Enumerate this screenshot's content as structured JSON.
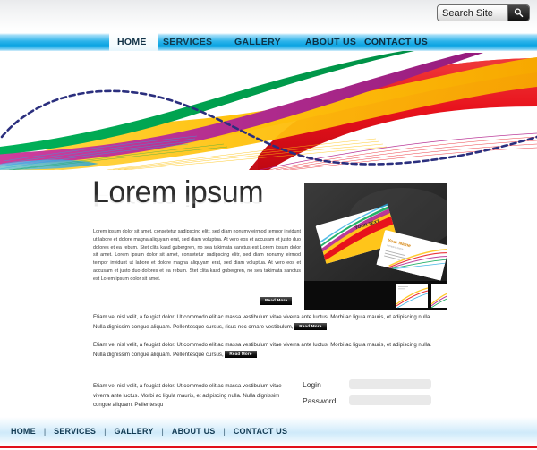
{
  "search": {
    "value": "Search Site",
    "placeholder": "Search Site",
    "icon": "magnifier-icon"
  },
  "nav": {
    "items": [
      {
        "label": "HOME",
        "active": true
      },
      {
        "label": "SERVICES",
        "active": false
      },
      {
        "label": "GALLERY",
        "active": false
      },
      {
        "label": "ABOUT US",
        "active": false
      },
      {
        "label": "CONTACT US",
        "active": false
      }
    ]
  },
  "banner": {
    "alt": "colorful flowing ribbon wave graphic",
    "colors": {
      "yellow": "#ffc20e",
      "red": "#e8121c",
      "magenta": "#b2238d",
      "green": "#00a44f",
      "cyan": "#29abe2",
      "navy_dashed": "#2b2f7e"
    }
  },
  "main": {
    "headline": "Lorem ipsum",
    "lead": "Lorem ipsum dolor sit amet, consetetur sadipscing elitr, sed diam nonumy eirmod tempor invidunt ut labore et dolore magna aliquyam erat, sed diam voluptua. At vero eos et accusam et justo duo dolores et ea rebum. Stet clita kasd gubergren, no sea takimata sanctus est Lorem ipsum dolor sit amet. Lorem ipsum dolor sit amet, consetetur sadipscing elitr, sed diam nonumy eirmod tempor invidunt ut labore et dolore magna aliquyam erat, sed diam voluptua. At vero eos et accusam et justo duo dolores et ea rebum. Stet clita kasd gubergren, no sea takimata sanctus est Lorem ipsum dolor sit amet.",
    "read_more": "Read More",
    "promo_image": {
      "alt": "business card design mockup on dark background",
      "card_text": "YOUR TEXT",
      "card_name": "Your Name"
    },
    "paragraph_1": "Etiam vel nisl velit, a feugiat dolor. Ut commodo elit ac massa vestibulum vitae viverra ante luctus. Morbi ac ligula mauris, et adipiscing nulla. Nulla dignissim congue aliquam. Pellentesque cursus, risus nec ornare vestibulum,",
    "paragraph_2": "Etiam vel nisl velit, a feugiat dolor. Ut commodo elit ac massa vestibulum vitae viverra ante luctus. Morbi ac ligula mauris, et adipiscing nulla. Nulla dignissim congue aliquam. Pellentesque cursus,",
    "bottom_text": "Etiam vel nisl velit, a feugiat dolor. Ut commodo elit ac massa vestibulum vitae viverra ante luctus. Morbi ac ligula mauris, et adipiscing nulla. Nulla dignissim congue aliquam. Pellentesqu"
  },
  "login": {
    "login_label": "Login",
    "password_label": "Password",
    "login_value": "",
    "password_value": "",
    "login_placeholder": "",
    "password_placeholder": ""
  },
  "footer": {
    "separator": "|",
    "items": [
      {
        "label": "HOME"
      },
      {
        "label": "SERVICES"
      },
      {
        "label": "GALLERY"
      },
      {
        "label": "ABOUT US"
      },
      {
        "label": "CONTACT US"
      }
    ],
    "accent_color": "#e1101b"
  }
}
